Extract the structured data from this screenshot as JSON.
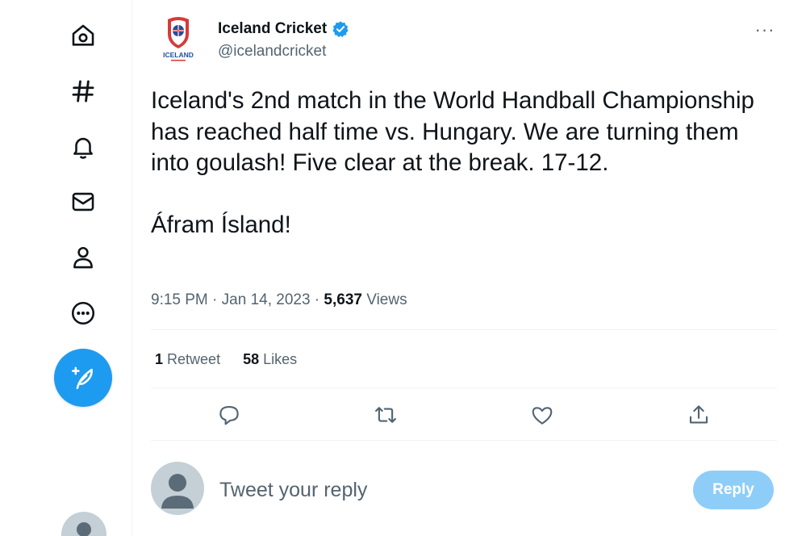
{
  "nav": {
    "items": [
      {
        "name": "home",
        "icon": "home-icon"
      },
      {
        "name": "explore",
        "icon": "hashtag-icon"
      },
      {
        "name": "notifications",
        "icon": "bell-icon"
      },
      {
        "name": "messages",
        "icon": "envelope-icon"
      },
      {
        "name": "profile",
        "icon": "person-icon"
      },
      {
        "name": "more",
        "icon": "more-circle-icon"
      }
    ],
    "compose_icon": "feather-plus-icon"
  },
  "tweet": {
    "author": {
      "name": "Iceland Cricket",
      "handle": "@icelandcricket",
      "verified": true,
      "avatar_logo_text": "ICELAND"
    },
    "more_label": "···",
    "text": "Iceland's 2nd match in the World Handball Championship has reached half time vs. Hungary. We are turning them into goulash! Five clear at the break. 17-12.\n\nÁfram Ísland!",
    "time": "9:15 PM",
    "separator": " · ",
    "date": "Jan 14, 2023",
    "views_count": "5,637",
    "views_label": "Views",
    "stats": {
      "retweets_count": "1",
      "retweets_label": "Retweet",
      "likes_count": "58",
      "likes_label": "Likes"
    },
    "actions": [
      "reply-icon",
      "retweet-icon",
      "like-icon",
      "share-icon"
    ]
  },
  "reply_box": {
    "placeholder": "Tweet your reply",
    "button_label": "Reply"
  },
  "colors": {
    "accent": "#1d9bf0",
    "accent_disabled": "#8ecdf8",
    "text_primary": "#0f1419",
    "text_secondary": "#536471",
    "divider": "#eff3f4"
  }
}
